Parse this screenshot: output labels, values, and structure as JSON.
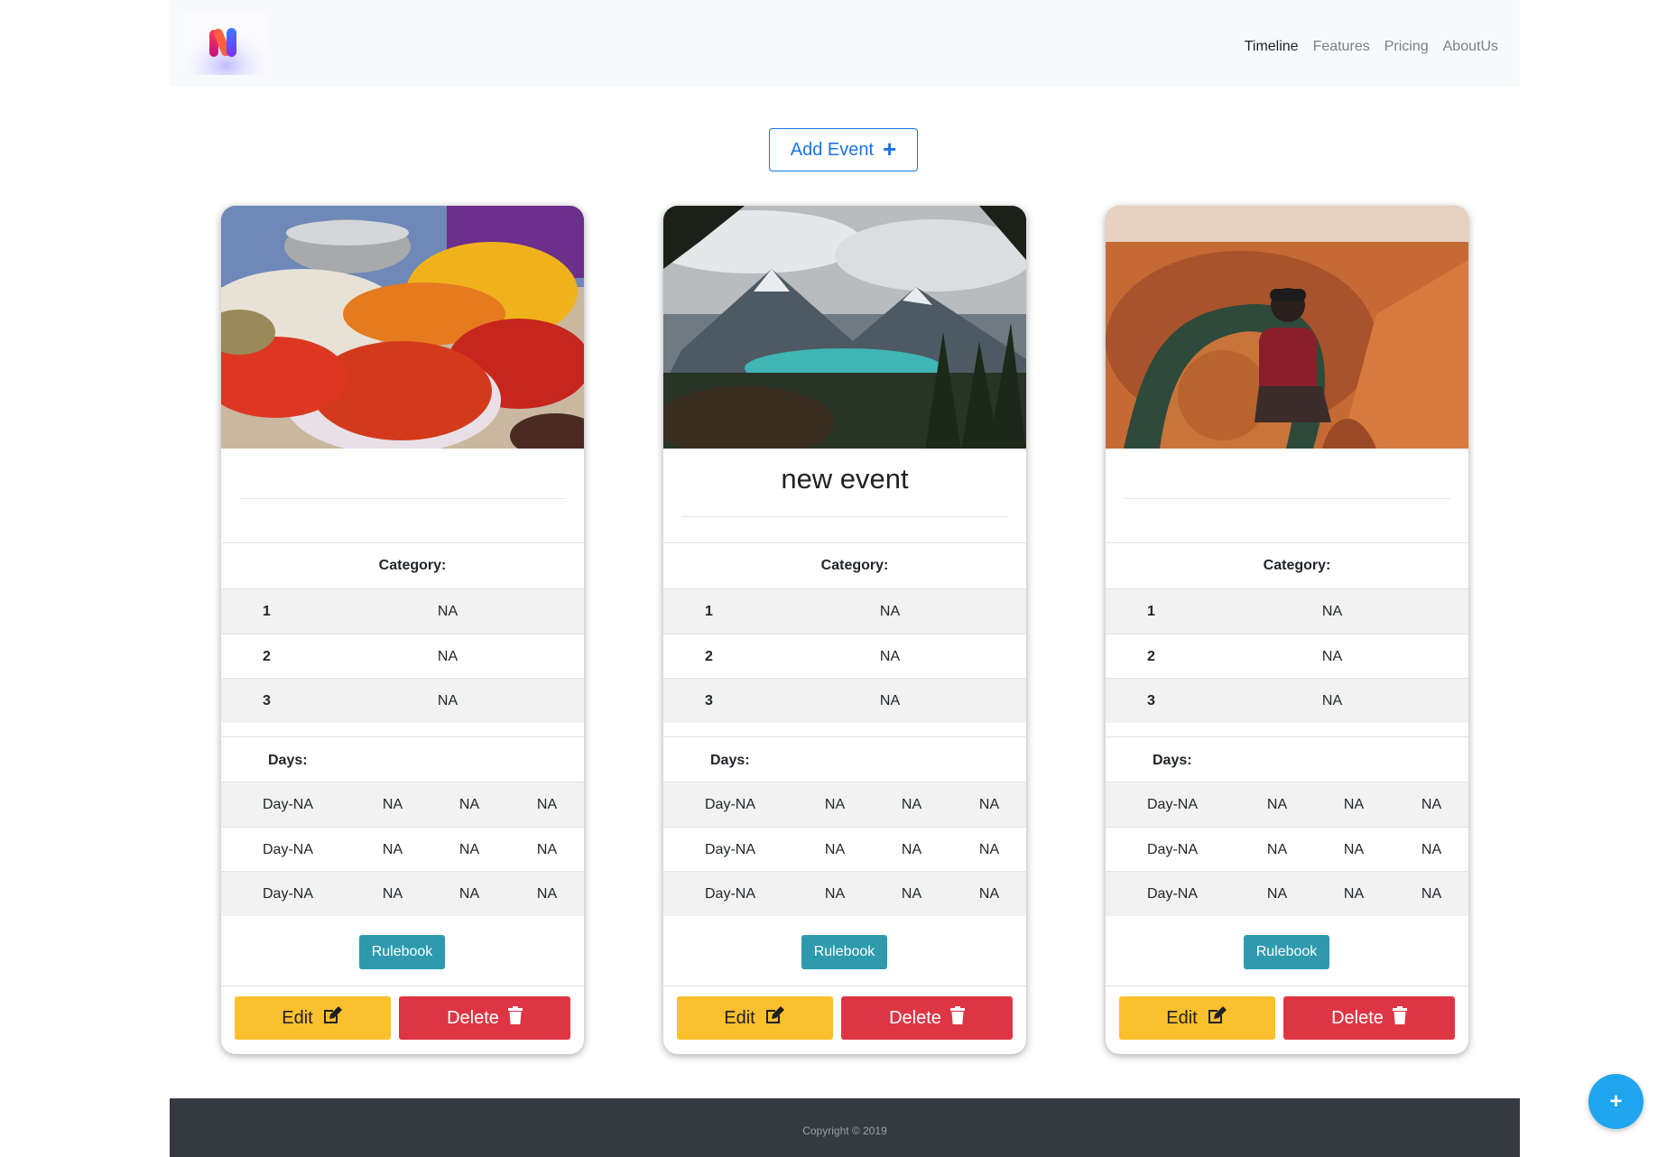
{
  "nav": {
    "links": [
      "Timeline",
      "Features",
      "Pricing",
      "AboutUs"
    ]
  },
  "add_event": {
    "label": "Add Event",
    "icon": "plus-icon"
  },
  "cards": [
    {
      "image": "spices-market-photo",
      "title": "",
      "category_header": "Category:",
      "category_rows": [
        {
          "num": "1",
          "value": "NA"
        },
        {
          "num": "2",
          "value": "NA"
        },
        {
          "num": "3",
          "value": "NA"
        }
      ],
      "days_header": "Days:",
      "day_rows": [
        [
          "Day-NA",
          "NA",
          "NA",
          "NA"
        ],
        [
          "Day-NA",
          "NA",
          "NA",
          "NA"
        ],
        [
          "Day-NA",
          "NA",
          "NA",
          "NA"
        ]
      ],
      "rulebook_label": "Rulebook",
      "edit_label": "Edit",
      "delete_label": "Delete"
    },
    {
      "image": "mountain-lake-photo",
      "title": "new event",
      "category_header": "Category:",
      "category_rows": [
        {
          "num": "1",
          "value": "NA"
        },
        {
          "num": "2",
          "value": "NA"
        },
        {
          "num": "3",
          "value": "NA"
        }
      ],
      "days_header": "Days:",
      "day_rows": [
        [
          "Day-NA",
          "NA",
          "NA",
          "NA"
        ],
        [
          "Day-NA",
          "NA",
          "NA",
          "NA"
        ],
        [
          "Day-NA",
          "NA",
          "NA",
          "NA"
        ]
      ],
      "rulebook_label": "Rulebook",
      "edit_label": "Edit",
      "delete_label": "Delete"
    },
    {
      "image": "canyon-hiker-photo",
      "title": "",
      "category_header": "Category:",
      "category_rows": [
        {
          "num": "1",
          "value": "NA"
        },
        {
          "num": "2",
          "value": "NA"
        },
        {
          "num": "3",
          "value": "NA"
        }
      ],
      "days_header": "Days:",
      "day_rows": [
        [
          "Day-NA",
          "NA",
          "NA",
          "NA"
        ],
        [
          "Day-NA",
          "NA",
          "NA",
          "NA"
        ],
        [
          "Day-NA",
          "NA",
          "NA",
          "NA"
        ]
      ],
      "rulebook_label": "Rulebook",
      "edit_label": "Edit",
      "delete_label": "Delete"
    }
  ],
  "footer": {
    "copyright": "Copyright © 2019"
  },
  "fab": {
    "label": "+"
  },
  "colors": {
    "primary": "#1b73e8",
    "warning": "#fbc02d",
    "danger": "#de3545",
    "info": "#2f9aad",
    "fab": "#1fa5ee",
    "footer": "#343a40"
  }
}
